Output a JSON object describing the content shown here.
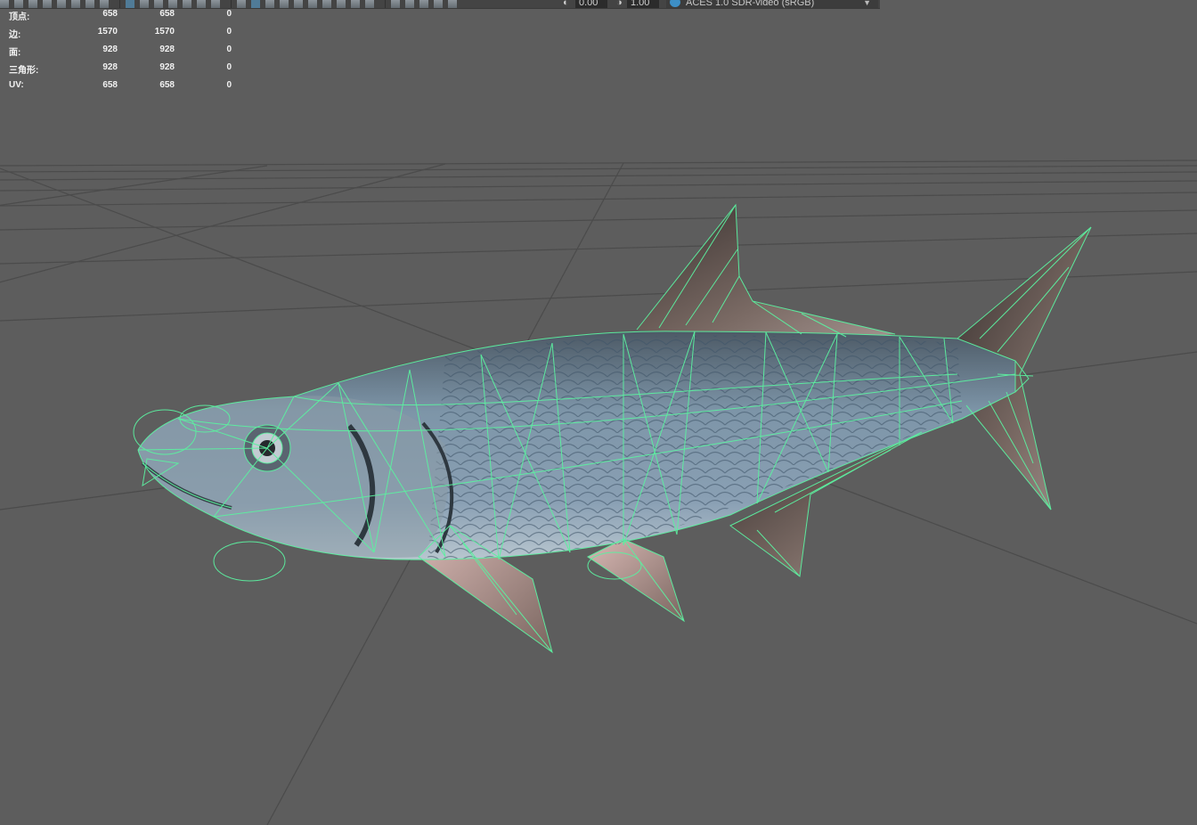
{
  "toolbar": {
    "exposure_value": "0.00",
    "gamma_value": "1.00",
    "color_space": "ACES 1.0 SDR-video (sRGB)",
    "icons": [
      "select-icon",
      "lasso-icon",
      "paint-icon",
      "move-icon",
      "rotate-icon",
      "scale-icon",
      "grid-toggle-icon",
      "camera-icon",
      "wireframe-icon",
      "shaded-icon",
      "textured-icon",
      "lighting-icon",
      "shadow-icon",
      "xray-icon",
      "isolate-icon",
      "exposure-icon",
      "gamma-icon",
      "color-management-icon"
    ]
  },
  "hud": {
    "rows": [
      {
        "label": "顶点:",
        "v1": "658",
        "v2": "658",
        "v3": "0"
      },
      {
        "label": "边:",
        "v1": "1570",
        "v2": "1570",
        "v3": "0"
      },
      {
        "label": "面:",
        "v1": "928",
        "v2": "928",
        "v3": "0"
      },
      {
        "label": "三角形:",
        "v1": "928",
        "v2": "928",
        "v3": "0"
      },
      {
        "label": "UV:",
        "v1": "658",
        "v2": "658",
        "v3": "0"
      }
    ]
  },
  "colors": {
    "viewport_bg": "#5d5d5d",
    "grid_line": "#4a4a4a",
    "wireframe": "#5cf0a0",
    "fish_body": "#7d95a6"
  },
  "model": {
    "object": "tarpon fish mesh",
    "display_mode": "wireframe on shaded"
  }
}
